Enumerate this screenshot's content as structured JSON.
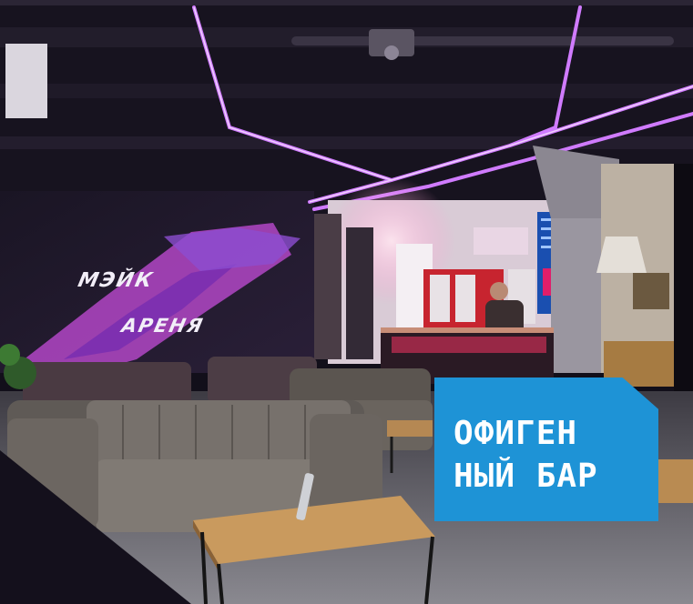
{
  "wall_sign": {
    "line1": "МЭЙК",
    "line2": "АРЕНЯ"
  },
  "badge": {
    "line1": "ОФИГЕН",
    "line2": "НЫЙ БАР",
    "color": "#1e93d6"
  },
  "colors": {
    "neon": "#d07bff",
    "ceiling": "#14111c",
    "sofa": "#6f6b66",
    "table": "#c99a5e"
  }
}
